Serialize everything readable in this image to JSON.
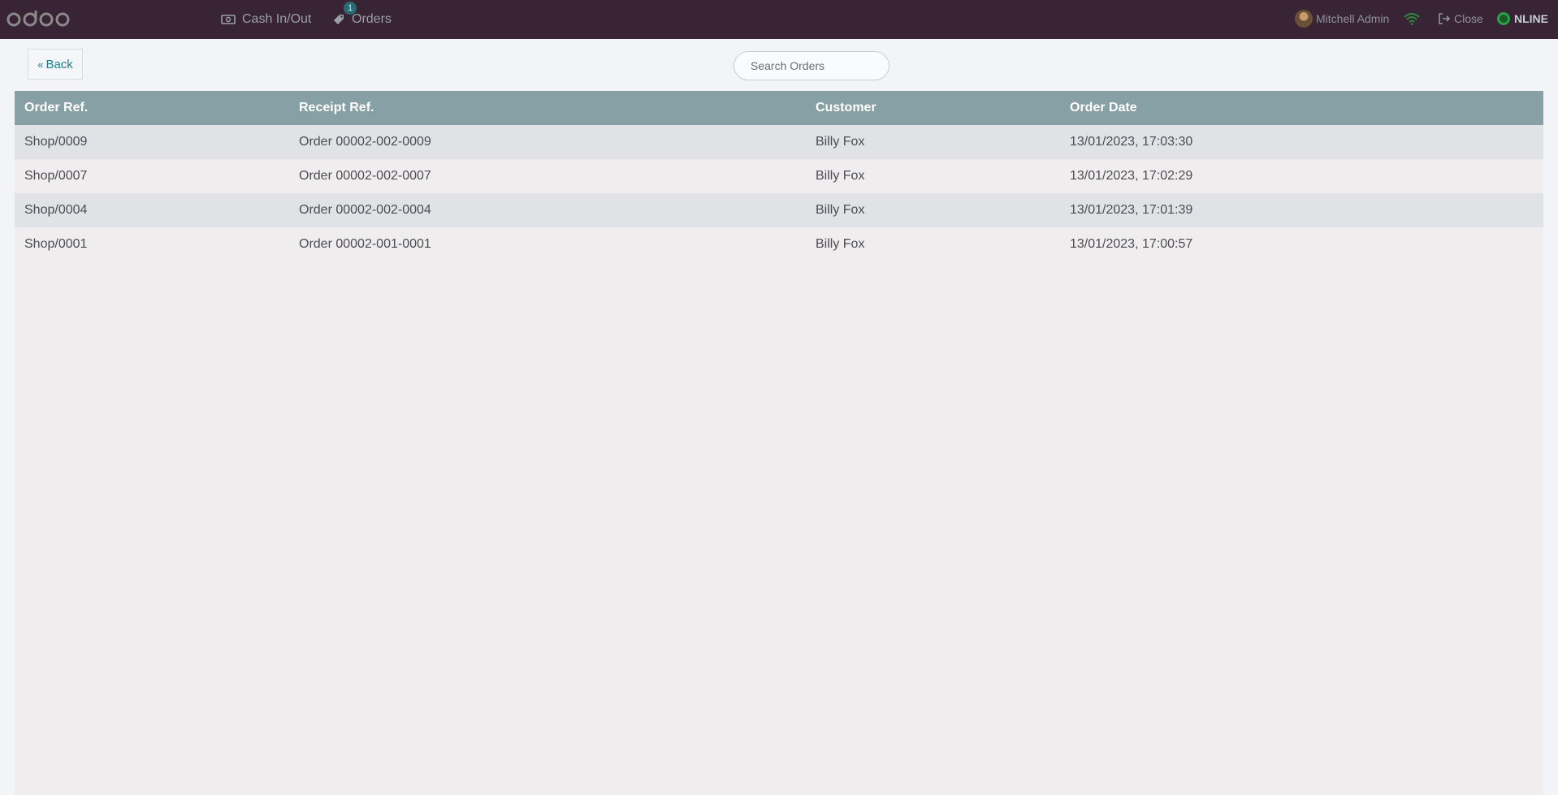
{
  "header": {
    "logo_text": "odoo",
    "nav": [
      {
        "label": "Cash In/Out",
        "icon": "money-icon"
      },
      {
        "label": "Orders",
        "icon": "tag-icon",
        "badge": "1"
      }
    ],
    "user": {
      "name": "Mitchell Admin",
      "icon": "avatar"
    },
    "close_label": "Close",
    "status_label": "NLINE",
    "colors": {
      "topbar": "#382434",
      "accent": "#1e7e89",
      "status_green": "#27a046"
    }
  },
  "controls": {
    "back_label": "Back",
    "search_placeholder": "Search Orders"
  },
  "table": {
    "columns": [
      "Order Ref.",
      "Receipt Ref.",
      "Customer",
      "Order Date"
    ],
    "rows": [
      {
        "order_ref": "Shop/0009",
        "receipt_ref": "Order 00002-002-0009",
        "customer": "Billy Fox",
        "date": "13/01/2023, 17:03:30"
      },
      {
        "order_ref": "Shop/0007",
        "receipt_ref": "Order 00002-002-0007",
        "customer": "Billy Fox",
        "date": "13/01/2023, 17:02:29"
      },
      {
        "order_ref": "Shop/0004",
        "receipt_ref": "Order 00002-002-0004",
        "customer": "Billy Fox",
        "date": "13/01/2023, 17:01:39"
      },
      {
        "order_ref": "Shop/0001",
        "receipt_ref": "Order 00002-001-0001",
        "customer": "Billy Fox",
        "date": "13/01/2023, 17:00:57"
      }
    ]
  }
}
